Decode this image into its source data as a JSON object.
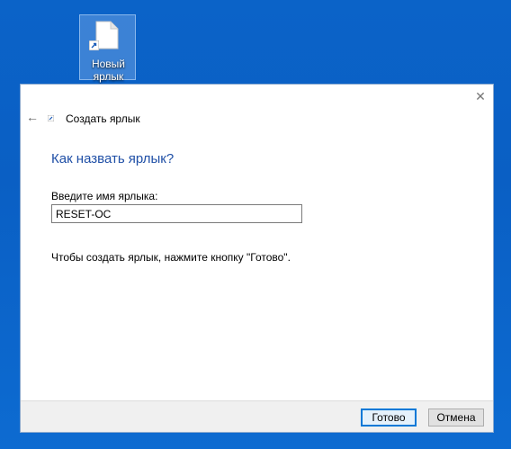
{
  "desktop": {
    "icon_label_line1": "Новый",
    "icon_label_line2": "ярлык",
    "icon_name": "shortcut-file-icon"
  },
  "dialog": {
    "close_glyph": "✕",
    "back_glyph": "←",
    "title": "Создать ярлык",
    "heading": "Как назвать ярлык?",
    "name_label": "Введите имя ярлыка:",
    "name_value": "RESET-OC",
    "hint": "Чтобы создать ярлык, нажмите кнопку \"Готово\".",
    "buttons": {
      "finish": "Готово",
      "cancel": "Отмена"
    }
  },
  "colors": {
    "desktop_bg": "#0b63c8",
    "heading": "#1f4fa6",
    "accent": "#0078d7"
  }
}
